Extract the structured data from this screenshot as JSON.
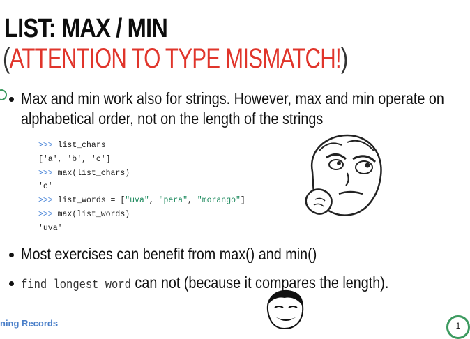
{
  "slide": {
    "title": "LIST: MAX / MIN",
    "subtitle": {
      "open_paren": "(",
      "text": "ATTENTION TO TYPE MISMATCH!",
      "close_paren": ")"
    },
    "bullets": [
      {
        "line1": "Max and min work also for strings. However, max and min operate on",
        "line2": "alphabetical order, not on the length of the strings"
      },
      {
        "text": "Most exercises can benefit from max() and min()"
      },
      {
        "code": "find_longest_word",
        "text": " can not (because it compares the length)."
      }
    ],
    "code_example": {
      "lines": [
        {
          "prompt": ">>> ",
          "text": "list_chars"
        },
        {
          "prompt": "",
          "text": "['a', 'b', 'c']"
        },
        {
          "prompt": ">>> ",
          "text": "max(list_chars)"
        },
        {
          "prompt": "",
          "text": "'c'"
        },
        {
          "prompt": ">>> ",
          "text": "list_words = [",
          "strs": [
            "\"uva\"",
            "\"pera\"",
            "\"morango\""
          ],
          "end": "]"
        },
        {
          "prompt": ">>> ",
          "text": "max(list_words)"
        },
        {
          "prompt": "",
          "text": "'uva'"
        }
      ]
    },
    "footer": "ning Records",
    "page_number": "1",
    "images": [
      "thinking-face-meme",
      "grinning-face-meme"
    ],
    "colors": {
      "accent_red": "#e0352b",
      "footer_blue": "#4a7fc9",
      "ring_green": "#3c9a5f"
    }
  }
}
